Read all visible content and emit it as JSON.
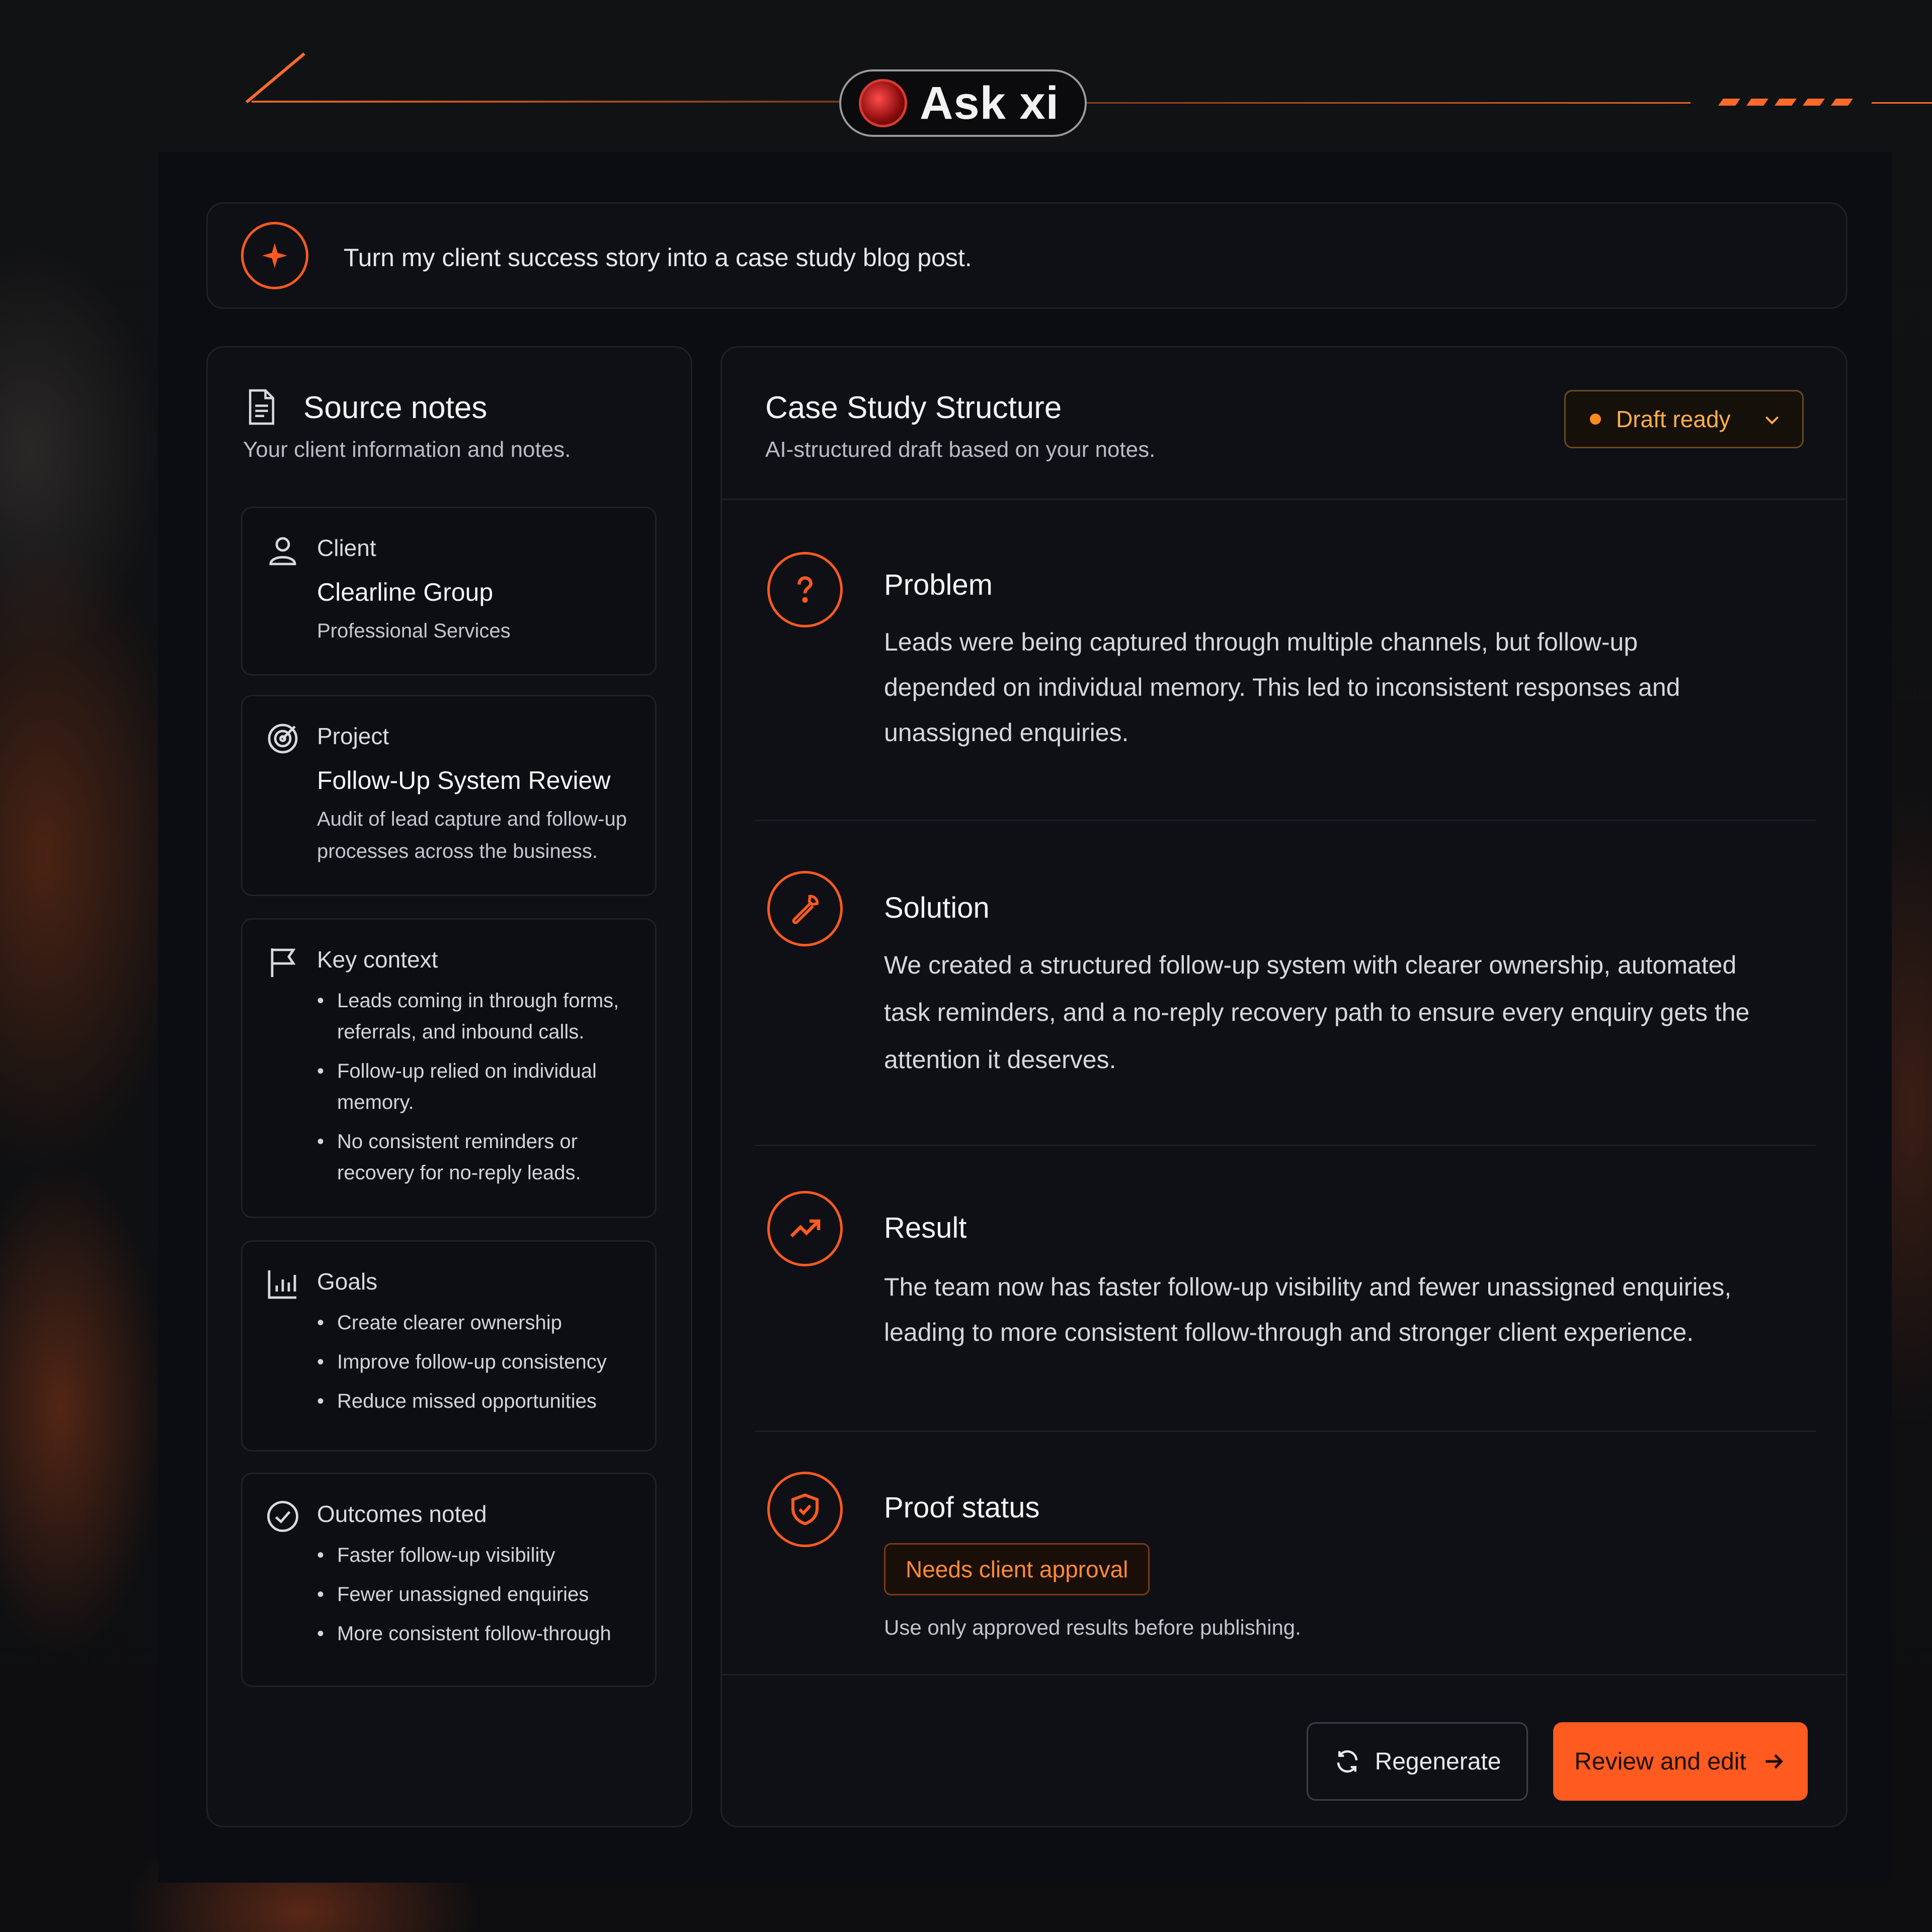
{
  "brand": {
    "name": "Ask xi"
  },
  "prompt": {
    "text": "Turn my client success story into a case study blog post."
  },
  "source_notes": {
    "title": "Source notes",
    "subtitle": "Your client information and notes.",
    "client": {
      "label": "Client",
      "name": "Clearline Group",
      "sector": "Professional Services"
    },
    "project": {
      "label": "Project",
      "name": "Follow-Up System Review",
      "description_lines": [
        "Audit of lead capture and follow-up",
        "processes across the business."
      ]
    },
    "key_context": {
      "label": "Key context",
      "items": [
        "Leads coming in through forms, referrals, and inbound calls.",
        "Follow-up relied on individual memory.",
        "No consistent reminders or recovery for no-reply leads."
      ]
    },
    "goals": {
      "label": "Goals",
      "items": [
        "Create clearer ownership",
        "Improve follow-up consistency",
        "Reduce missed opportunities"
      ]
    },
    "outcomes": {
      "label": "Outcomes noted",
      "items": [
        "Faster follow-up visibility",
        "Fewer unassigned enquiries",
        "More consistent follow-through"
      ]
    }
  },
  "case_study": {
    "title": "Case Study Structure",
    "subtitle": "AI-structured draft based on your notes.",
    "status": "Draft ready",
    "sections": {
      "problem": {
        "heading": "Problem",
        "body_lines": [
          "Leads were being captured through multiple channels, but follow-up",
          "depended on individual memory. This led to inconsistent responses and",
          "unassigned enquiries."
        ]
      },
      "solution": {
        "heading": "Solution",
        "body_lines": [
          "We created a structured follow-up system with clearer ownership, automated",
          "task reminders, and a no-reply recovery path to ensure every enquiry gets the",
          "attention it deserves."
        ]
      },
      "result": {
        "heading": "Result",
        "body_lines": [
          "The team now has faster follow-up visibility and fewer unassigned enquiries,",
          "leading to more consistent follow-through and stronger client experience."
        ]
      },
      "proof": {
        "heading": "Proof status",
        "badge": "Needs client approval",
        "note": "Use only approved results before publishing."
      }
    },
    "actions": {
      "regenerate": "Regenerate",
      "review": "Review and edit"
    }
  },
  "colors": {
    "accent": "#ff5a1f",
    "status": "#ffae4a",
    "background": "#0b0d12"
  },
  "icons": {
    "prompt": "sparkle-icon",
    "source": "document-icon",
    "client": "user-icon",
    "project": "target-icon",
    "context": "flag-icon",
    "goals": "bar-chart-icon",
    "outcomes": "check-circle-icon",
    "problem": "question-icon",
    "solution": "wrench-icon",
    "result": "trend-up-icon",
    "proof": "shield-check-icon",
    "regenerate": "refresh-icon",
    "review": "arrow-right-icon",
    "status": "chevron-down-icon"
  }
}
